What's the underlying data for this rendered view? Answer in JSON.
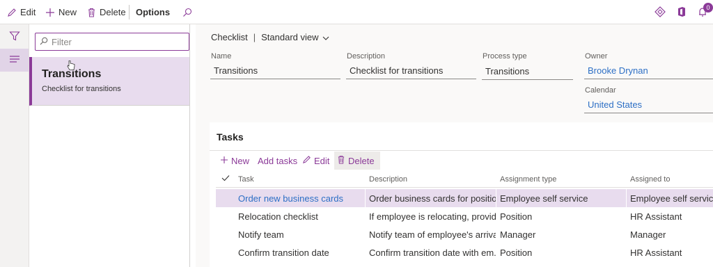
{
  "toolbar": {
    "edit_label": "Edit",
    "new_label": "New",
    "delete_label": "Delete",
    "options_label": "Options",
    "notification_count": "0"
  },
  "list": {
    "filter_placeholder": "Filter",
    "items": [
      {
        "title": "Transitions",
        "subtitle": "Checklist for transitions"
      }
    ]
  },
  "details": {
    "breadcrumb": {
      "page": "Checklist",
      "separator": "|",
      "view": "Standard view"
    },
    "fields": {
      "name": {
        "label": "Name",
        "value": "Transitions"
      },
      "description": {
        "label": "Description",
        "value": "Checklist for transitions"
      },
      "process_type": {
        "label": "Process type",
        "value": "Transitions"
      },
      "owner": {
        "label": "Owner",
        "value": "Brooke Drynan"
      },
      "calendar": {
        "label": "Calendar",
        "value": "United States"
      }
    }
  },
  "tasks": {
    "title": "Tasks",
    "toolbar": {
      "new_label": "New",
      "add_tasks_label": "Add tasks",
      "edit_label": "Edit",
      "delete_label": "Delete"
    },
    "columns": [
      "Task",
      "Description",
      "Assignment type",
      "Assigned to"
    ],
    "rows": [
      {
        "task": "Order new business cards",
        "description": "Order business cards for positio...",
        "assignment_type": "Employee self service",
        "assigned_to": "Employee self service"
      },
      {
        "task": "Relocation checklist",
        "description": "If employee is relocating, provid...",
        "assignment_type": "Position",
        "assigned_to": "HR Assistant"
      },
      {
        "task": "Notify team",
        "description": "Notify team of employee's arrival",
        "assignment_type": "Manager",
        "assigned_to": "Manager"
      },
      {
        "task": "Confirm transition date",
        "description": "Confirm transition date with em...",
        "assignment_type": "Position",
        "assigned_to": "HR Assistant"
      }
    ]
  },
  "colors": {
    "accent": "#8b3a98",
    "selected_row": "#e8dcee",
    "link": "#2d6fc5"
  },
  "icons": [
    "pencil-icon",
    "plus-icon",
    "trash-icon",
    "search-icon",
    "diamond-icon",
    "office-icon",
    "bell-icon",
    "filter-icon",
    "list-icon",
    "chevron-down-icon",
    "checkmark-icon"
  ]
}
